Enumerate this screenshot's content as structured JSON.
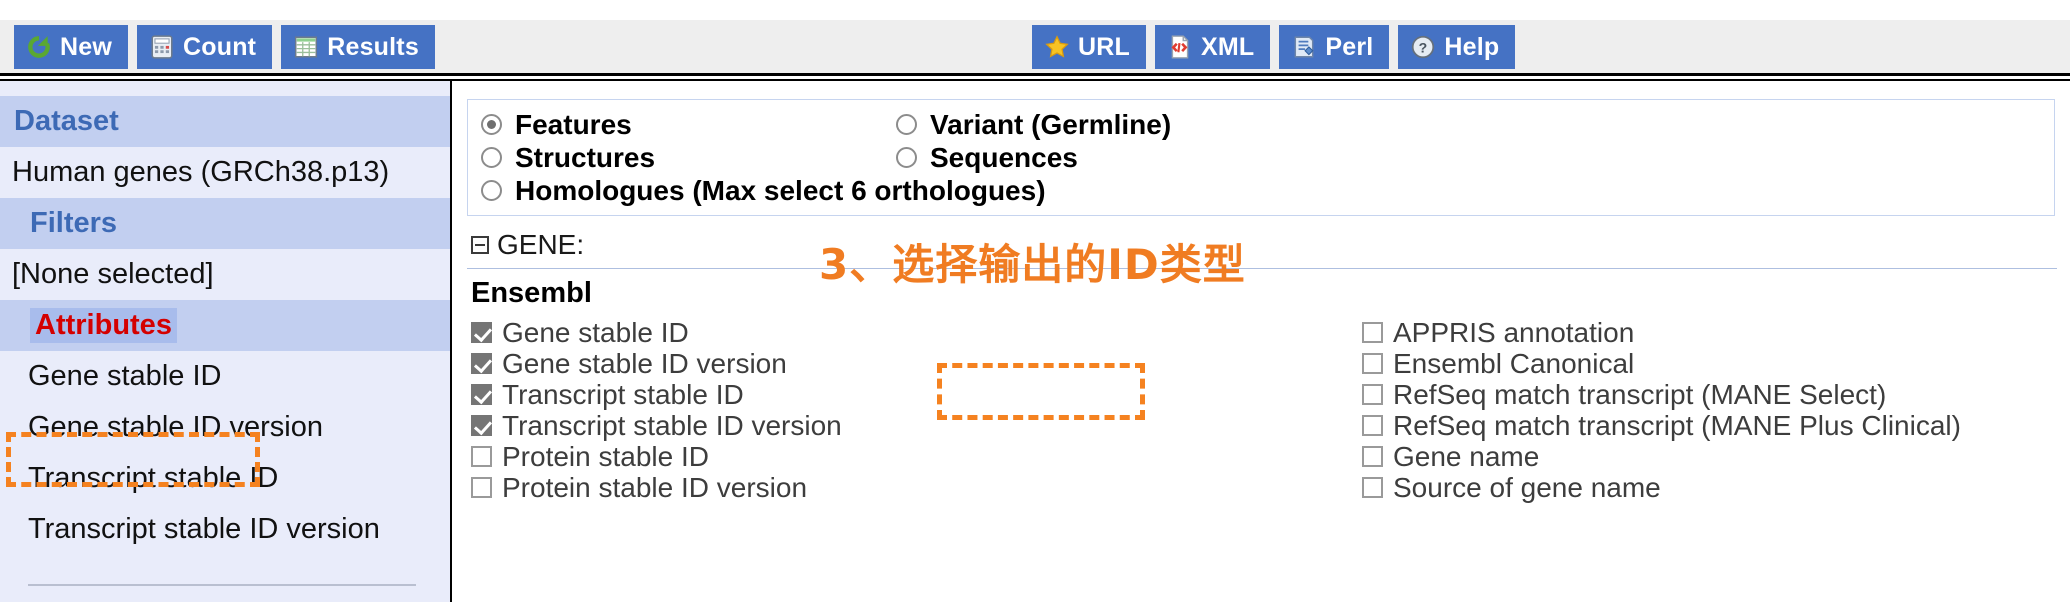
{
  "toolbar": {
    "left_buttons": [
      {
        "label": "New",
        "icon": "refresh-icon"
      },
      {
        "label": "Count",
        "icon": "calculator-icon"
      },
      {
        "label": "Results",
        "icon": "table-icon"
      }
    ],
    "right_buttons": [
      {
        "label": "URL",
        "icon": "star-icon"
      },
      {
        "label": "XML",
        "icon": "xml-file-icon"
      },
      {
        "label": "Perl",
        "icon": "perl-icon"
      },
      {
        "label": "Help",
        "icon": "question-icon"
      }
    ]
  },
  "sidebar": {
    "dataset_header": "Dataset",
    "dataset_value": "Human genes (GRCh38.p13)",
    "filters_header": "Filters",
    "filters_value": "[None selected]",
    "attributes_header": "Attributes",
    "attribute_items": [
      "Gene stable ID",
      "Gene stable ID version",
      "Transcript stable ID",
      "Transcript stable ID version"
    ]
  },
  "main": {
    "radio_left": [
      {
        "label": "Features",
        "selected": true
      },
      {
        "label": "Structures",
        "selected": false
      },
      {
        "label": "Homologues (Max select 6 orthologues)",
        "selected": false
      }
    ],
    "radio_right": [
      {
        "label": "Variant (Germline)",
        "selected": false
      },
      {
        "label": "Sequences",
        "selected": false
      }
    ],
    "gene_section_label": "GENE:",
    "ensembl_label": "Ensembl",
    "checkboxes_left": [
      {
        "label": "Gene stable ID",
        "checked": true
      },
      {
        "label": "Gene stable ID version",
        "checked": true
      },
      {
        "label": "Transcript stable ID",
        "checked": true
      },
      {
        "label": "Transcript stable ID version",
        "checked": true
      },
      {
        "label": "Protein stable ID",
        "checked": false
      },
      {
        "label": "Protein stable ID version",
        "checked": false
      }
    ],
    "checkboxes_right": [
      {
        "label": "APPRIS annotation",
        "checked": false
      },
      {
        "label": "Ensembl Canonical",
        "checked": false
      },
      {
        "label": "RefSeq match transcript (MANE Select)",
        "checked": false
      },
      {
        "label": "RefSeq match transcript (MANE Plus Clinical)",
        "checked": false
      },
      {
        "label": "Gene name",
        "checked": false
      },
      {
        "label": "Source of gene name",
        "checked": false
      }
    ]
  },
  "annotations": {
    "caption": "3、选择输出的ID类型",
    "highlight_color": "#f58220"
  },
  "colors": {
    "button_blue": "#4572c4",
    "toolbar_gray": "#eeeeee",
    "sidebar_light": "#e9ecfa",
    "sidebar_band": "#c2cff0",
    "sidebar_header_text": "#3d6ab5",
    "selected_text": "#d40000",
    "annotation_orange": "#f58220"
  }
}
